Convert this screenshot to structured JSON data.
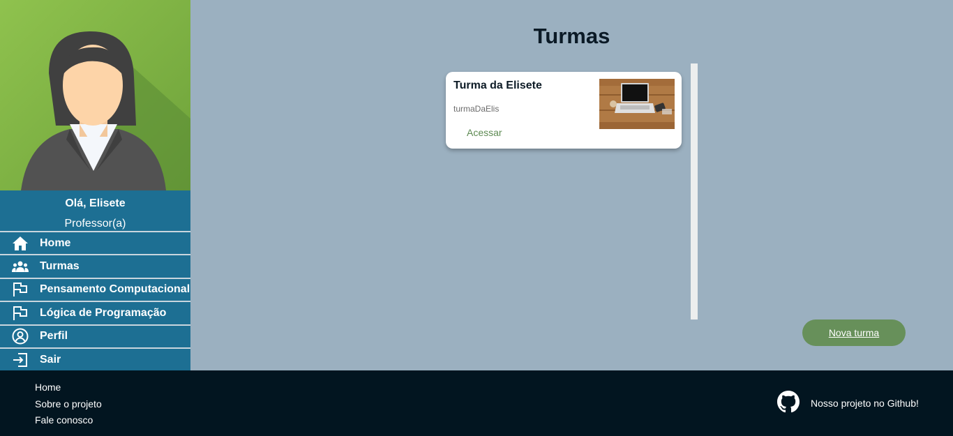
{
  "sidebar": {
    "greeting": "Olá, Elisete",
    "role": "Professor(a)",
    "items": [
      {
        "label": "Home",
        "icon": "home-icon"
      },
      {
        "label": "Turmas",
        "icon": "users-icon"
      },
      {
        "label": "Pensamento Computacional",
        "icon": "flag-icon"
      },
      {
        "label": "Lógica de Programação",
        "icon": "flag-icon"
      },
      {
        "label": "Perfil",
        "icon": "user-circle-icon"
      },
      {
        "label": "Sair",
        "icon": "sign-out-icon"
      }
    ]
  },
  "main": {
    "title": "Turmas",
    "card": {
      "title": "Turma da Elisete",
      "code": "turmaDaElis",
      "link": "Acessar"
    },
    "new_button": "Nova turma"
  },
  "footer": {
    "links": [
      "Home",
      "Sobre o projeto",
      "Fale conosco"
    ],
    "github_text": "Nosso projeto no Github!"
  },
  "colors": {
    "sidebar": "#1d6f93",
    "main_bg": "#9bb0c0",
    "footer_bg": "#021520",
    "accent_green": "#67905a"
  }
}
